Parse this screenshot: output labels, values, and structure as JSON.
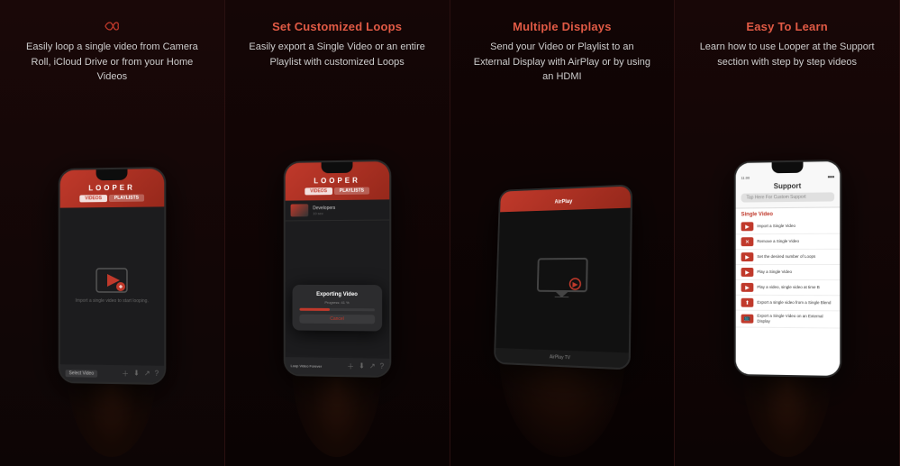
{
  "panels": [
    {
      "id": "panel-1",
      "title": "",
      "title_color": "#e05a45",
      "description": "Easily loop a single video from Camera Roll, iCloud Drive or from your Home Videos",
      "app_logo": "LOOPER",
      "tabs": [
        "VIDEOS",
        "PLAYLISTS"
      ],
      "active_tab": 0,
      "import_text": "Import a single video to start looping.",
      "select_label": "Select Video",
      "footer_icons": [
        "＋",
        "⬇",
        "↗",
        "?"
      ]
    },
    {
      "id": "panel-2",
      "title": "Set Customized Loops",
      "title_color": "#e05a45",
      "description": "Easily export a Single Video or an entire Playlist with customized Loops",
      "app_logo": "LOOPER",
      "tabs": [
        "VIDEOS",
        "PLAYLISTS"
      ],
      "active_tab": 0,
      "list_items": [
        {
          "name": "Developers",
          "duration": "10 sec"
        }
      ],
      "export_title": "Exporting Video",
      "export_progress_label": "Progress: 41 %",
      "cancel_label": "Cancel",
      "loop_label": "Loop Video Forever",
      "footer_icons": [
        "＋",
        "⬇",
        "↗",
        "?"
      ]
    },
    {
      "id": "panel-3",
      "title": "Multiple Displays",
      "title_color": "#e05a45",
      "description": "Send your Video or Playlist to an External Display with AirPlay or by using an HDMI",
      "airplay_label": "AirPlay TV"
    },
    {
      "id": "panel-4",
      "title": "Easy To Learn",
      "title_color": "#e05a45",
      "description": "Learn how to use Looper at the Support section with step by step videos",
      "support_title": "Support",
      "search_placeholder": "Tap Here For Custom Support",
      "section_title": "Single Video",
      "list_items": [
        "Import a Single Video",
        "Remove a Single Video",
        "Set the desired number of Loops",
        "Play a Single Video",
        "Play a video, single video at time B",
        "Export a single video from a Single Blend",
        "Export a Single Video on an External Display"
      ]
    }
  ]
}
